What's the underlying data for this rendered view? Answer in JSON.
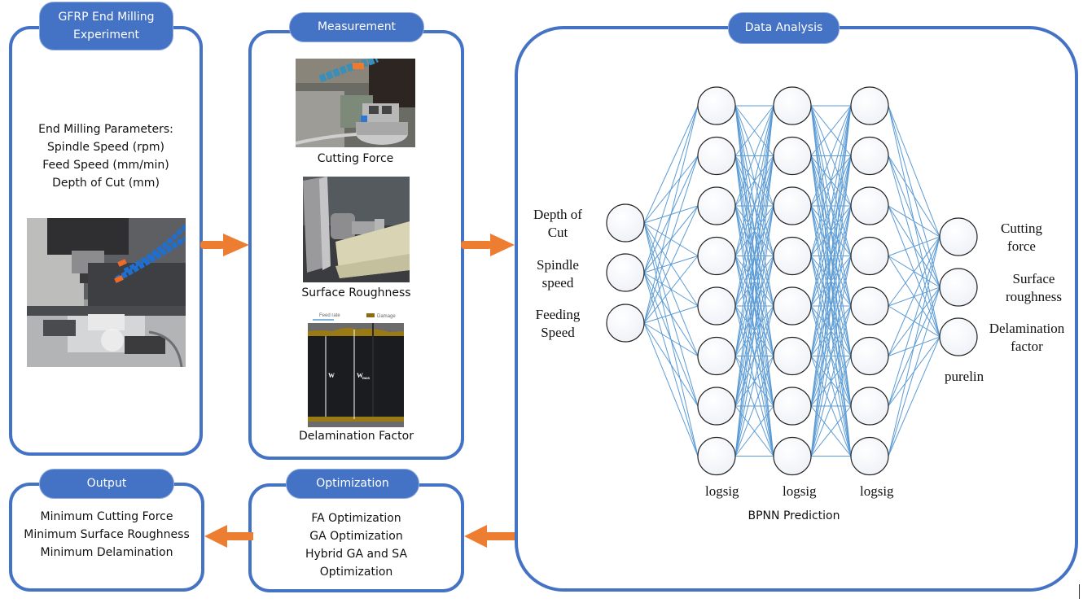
{
  "panels": {
    "experiment": {
      "title_lines": [
        "GFRP End Milling",
        "Experiment"
      ],
      "text_lines": [
        "End Milling Parameters:",
        "Spindle Speed (rpm)",
        "Feed Speed (mm/min)",
        "Depth of Cut (mm)"
      ],
      "photo": "cnc-milling-machine-photo"
    },
    "measurement": {
      "title": "Measurement",
      "items": [
        {
          "caption": "Cutting Force",
          "photo": "dynamometer-setup-photo"
        },
        {
          "caption": "Surface Roughness",
          "photo": "roughness-tester-photo"
        },
        {
          "caption": "Delamination Factor",
          "photo": "delamination-micrograph",
          "legend_feed": "Feed rate",
          "legend_damage": "Damage",
          "label_w": "W",
          "label_wmax": "W",
          "label_wmax_sub": "max"
        }
      ]
    },
    "analysis": {
      "title": "Data Analysis",
      "inputs": [
        "Depth of|Cut",
        "Spindle|speed",
        "Feeding|Speed"
      ],
      "outputs": [
        "Cutting|force",
        "Surface|roughness",
        "Delamination|factor"
      ],
      "hidden_activations": [
        "logsig",
        "logsig",
        "logsig"
      ],
      "output_activation": "purelin",
      "caption": "BPNN Prediction",
      "network": {
        "input_nodes": 3,
        "hidden_layers": [
          8,
          8,
          8
        ],
        "output_nodes": 3
      }
    },
    "optimization": {
      "title": "Optimization",
      "text_lines": [
        "FA Optimization",
        "GA Optimization",
        "Hybrid GA and SA",
        "Optimization"
      ]
    },
    "output": {
      "title": "Output",
      "text_lines": [
        "Minimum Cutting Force",
        "Minimum Surface Roughness",
        "Minimum Delamination"
      ]
    }
  },
  "colors": {
    "panel_border": "#4472c4",
    "tag_fill": "#4472c4",
    "arrow": "#ed7d31",
    "connection": "#5b9bd5",
    "node_stroke": "#222222"
  },
  "flow": [
    {
      "from": "experiment",
      "to": "measurement",
      "icon": "arrow-right-icon"
    },
    {
      "from": "measurement",
      "to": "analysis",
      "icon": "arrow-right-icon"
    },
    {
      "from": "analysis",
      "to": "optimization",
      "icon": "arrow-left-icon"
    },
    {
      "from": "optimization",
      "to": "output",
      "icon": "arrow-left-icon"
    }
  ]
}
